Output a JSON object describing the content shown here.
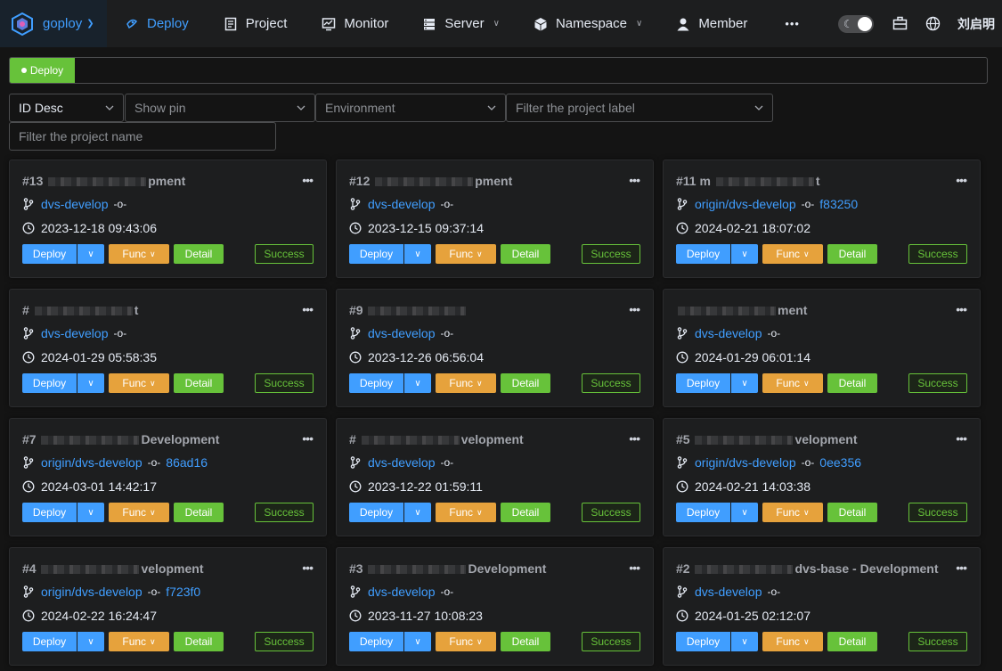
{
  "nav": {
    "brand": "goploy",
    "items": [
      {
        "label": "Deploy",
        "icon": "deploy-icon",
        "active": true,
        "dropdown": false
      },
      {
        "label": "Project",
        "icon": "project-icon",
        "active": false,
        "dropdown": false
      },
      {
        "label": "Monitor",
        "icon": "monitor-icon",
        "active": false,
        "dropdown": false
      },
      {
        "label": "Server",
        "icon": "server-icon",
        "active": false,
        "dropdown": true
      },
      {
        "label": "Namespace",
        "icon": "namespace-icon",
        "active": false,
        "dropdown": true
      },
      {
        "label": "Member",
        "icon": "member-icon",
        "active": false,
        "dropdown": false
      }
    ],
    "more": "•••",
    "username": "刘启明",
    "theme_toggle": "dark"
  },
  "tabs": [
    {
      "label": "Deploy"
    }
  ],
  "filters": {
    "sort": "ID Desc",
    "pin": "Show pin",
    "environment": "Environment",
    "label": "Filter the project label",
    "name_placeholder": "Filter the project name"
  },
  "card_buttons": {
    "deploy": "Deploy",
    "func": "Func",
    "detail": "Detail"
  },
  "projects": [
    {
      "id": "#13",
      "name_tail": "pment",
      "branch": "dvs-develop",
      "hash": "",
      "time": "2023-12-18 09:43:06",
      "status": "Success"
    },
    {
      "id": "#12",
      "name_tail": "pment",
      "branch": "dvs-develop",
      "hash": "",
      "time": "2023-12-15 09:37:14",
      "status": "Success"
    },
    {
      "id": "#11 m",
      "name_tail": "t",
      "branch": "origin/dvs-develop",
      "hash": "f83250",
      "time": "2024-02-21 18:07:02",
      "status": "Success"
    },
    {
      "id": "#",
      "name_tail": "t",
      "branch": "dvs-develop",
      "hash": "",
      "time": "2024-01-29 05:58:35",
      "status": "Success"
    },
    {
      "id": "#9",
      "name_tail": "",
      "branch": "dvs-develop",
      "hash": "",
      "time": "2023-12-26 06:56:04",
      "status": "Success"
    },
    {
      "id": "",
      "name_tail": "ment",
      "branch": "dvs-develop",
      "hash": "",
      "time": "2024-01-29 06:01:14",
      "status": "Success"
    },
    {
      "id": "#7",
      "name_tail": "Development",
      "branch": "origin/dvs-develop",
      "hash": "86ad16",
      "time": "2024-03-01 14:42:17",
      "status": "Success"
    },
    {
      "id": "#",
      "name_tail": "velopment",
      "branch": "dvs-develop",
      "hash": "",
      "time": "2023-12-22 01:59:11",
      "status": "Success"
    },
    {
      "id": "#5",
      "name_tail": "velopment",
      "branch": "origin/dvs-develop",
      "hash": "0ee356",
      "time": "2024-02-21 14:03:38",
      "status": "Success"
    },
    {
      "id": "#4",
      "name_tail": "velopment",
      "branch": "origin/dvs-develop",
      "hash": "f723f0",
      "time": "2024-02-22 16:24:47",
      "status": "Success"
    },
    {
      "id": "#3",
      "name_tail": "Development",
      "branch": "dvs-develop",
      "hash": "",
      "time": "2023-11-27 10:08:23",
      "status": "Success"
    },
    {
      "id": "#2",
      "name_tail": "dvs-base - Development",
      "branch": "dvs-develop",
      "hash": "",
      "time": "2024-01-25 02:12:07",
      "status": "Success"
    }
  ],
  "colors": {
    "primary": "#409eff",
    "success": "#67c23a",
    "warning": "#e6a23c",
    "bg": "#141414",
    "card": "#1d1e1f"
  }
}
